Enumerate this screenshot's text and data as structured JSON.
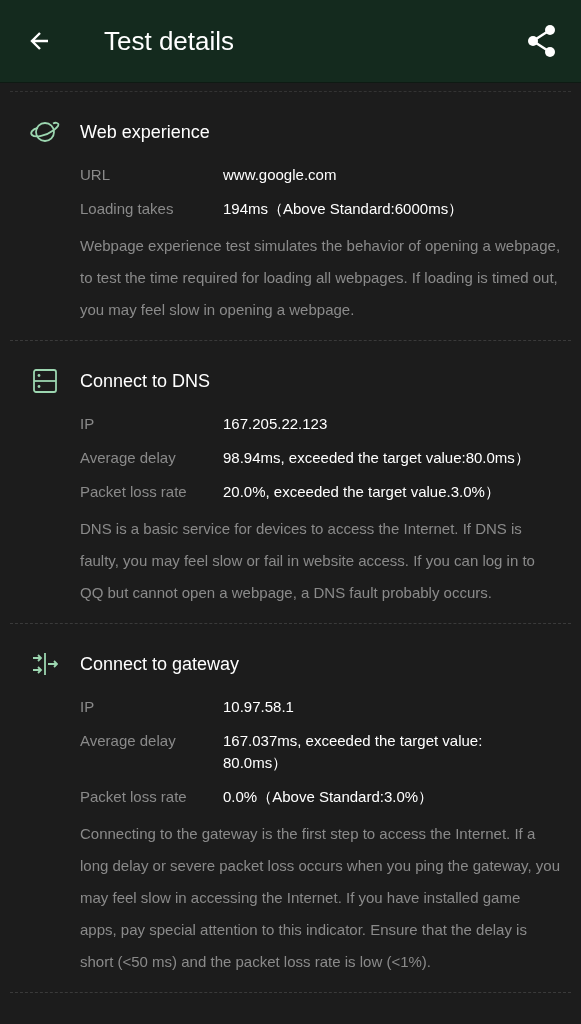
{
  "header": {
    "title": "Test details"
  },
  "sections": [
    {
      "kind": "planet",
      "title": "Web experience",
      "rows": [
        {
          "label": "URL",
          "value": "www.google.com"
        },
        {
          "label": "Loading takes",
          "value": "194ms（Above Standard:6000ms）"
        }
      ],
      "description": "Webpage experience test simulates the behavior of opening a webpage, to test the time required for loading all webpages. If loading is timed out, you may feel slow in opening a webpage."
    },
    {
      "kind": "server",
      "title": "Connect to DNS",
      "rows": [
        {
          "label": "IP",
          "value": "167.205.22.123"
        },
        {
          "label": "Average delay",
          "value": "98.94ms, exceeded the target value:80.0ms）"
        },
        {
          "label": "Packet loss rate",
          "value": "20.0%, exceeded the target value.3.0%）"
        }
      ],
      "description": "DNS is a basic service for devices to access the Internet. If DNS is faulty, you may feel slow or fail in website access. If you can log in to QQ but cannot open a webpage, a DNS fault probably occurs."
    },
    {
      "kind": "gateway",
      "title": "Connect to gateway",
      "rows": [
        {
          "label": "IP",
          "value": "10.97.58.1"
        },
        {
          "label": "Average delay",
          "value": "167.037ms, exceeded the target value: 80.0ms）"
        },
        {
          "label": "Packet loss rate",
          "value": "0.0%（Above Standard:3.0%）"
        }
      ],
      "description": "Connecting to the gateway is the first step to access the Internet. If a long delay or severe packet loss occurs when you ping the gateway, you may feel slow in accessing the Internet. If you have installed game apps, pay special attention to this indicator. Ensure that the delay is short (<50 ms) and the packet loss rate is low (<1%)."
    }
  ]
}
